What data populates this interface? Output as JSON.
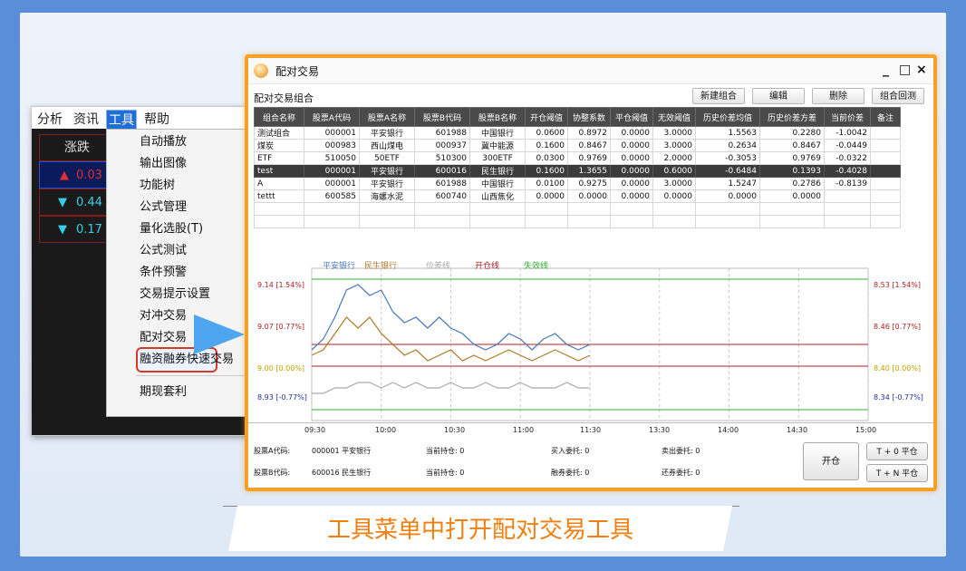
{
  "menu": {
    "bar": [
      "分析",
      "资讯",
      "工具",
      "帮助"
    ],
    "column_header": "涨跌",
    "values": [
      {
        "arrow": "▲",
        "value": "0.03",
        "color": "#e03030"
      },
      {
        "arrow": "▼",
        "value": "0.44",
        "color": "#35d0e8"
      },
      {
        "arrow": "▼",
        "value": "0.17",
        "color": "#35d0e8"
      }
    ],
    "items": [
      "自动播放",
      "输出图像",
      "功能树",
      "公式管理",
      "量化选股(T)",
      "公式测试",
      "条件预警",
      "交易提示设置",
      "对冲交易",
      "配对交易",
      "融资融券快速交易",
      "期现套利"
    ]
  },
  "window": {
    "title": "配对交易",
    "subtitle": "配对交易组合",
    "controls": [
      "_",
      "□",
      "×"
    ],
    "buttons": {
      "new": "新建组合",
      "edit": "编辑",
      "delete": "删除",
      "backtest": "组合回测"
    }
  },
  "table": {
    "headers": [
      "组合名称",
      "股票A代码",
      "股票A名称",
      "股票B代码",
      "股票B名称",
      "开仓阈值",
      "协整系数",
      "平仓阈值",
      "无效阈值",
      "历史价差均值",
      "历史价差方差",
      "当前价差",
      "备注"
    ],
    "rows": [
      [
        "测试组合",
        "000001",
        "平安银行",
        "601988",
        "中国银行",
        "0.0600",
        "0.8972",
        "0.0000",
        "3.0000",
        "1.5563",
        "0.2280",
        "-1.0042",
        ""
      ],
      [
        "煤炭",
        "000983",
        "西山煤电",
        "000937",
        "冀中能源",
        "0.1600",
        "0.8467",
        "0.0000",
        "3.0000",
        "0.2634",
        "0.8467",
        "-0.0449",
        ""
      ],
      [
        "ETF",
        "510050",
        "50ETF",
        "510300",
        "300ETF",
        "0.0300",
        "0.9769",
        "0.0000",
        "2.0000",
        "-0.3053",
        "0.9769",
        "-0.0322",
        ""
      ],
      [
        "test",
        "000001",
        "平安银行",
        "600016",
        "民生银行",
        "0.1600",
        "1.3655",
        "0.0000",
        "0.6000",
        "-0.6484",
        "0.1393",
        "-0.4028",
        ""
      ],
      [
        "A",
        "000001",
        "平安银行",
        "601988",
        "中国银行",
        "0.0100",
        "0.9275",
        "0.0000",
        "3.0000",
        "1.5247",
        "0.2786",
        "-0.8139",
        ""
      ],
      [
        "tettt",
        "600585",
        "海螺水泥",
        "600740",
        "山西焦化",
        "0.0000",
        "0.0000",
        "0.0000",
        "0.0000",
        "0.0000",
        "0.0000",
        "",
        ""
      ]
    ],
    "selected_row": 3
  },
  "chart_data": {
    "type": "line",
    "legend": [
      {
        "name": "平安银行",
        "color": "#4a78b8"
      },
      {
        "name": "民生银行",
        "color": "#b07a2c"
      },
      {
        "name": "价差线",
        "color": "#aaaaaa"
      },
      {
        "name": "开仓线",
        "color": "#b02020"
      },
      {
        "name": "失效线",
        "color": "#30b030"
      }
    ],
    "left_axis": [
      {
        "label": "9.14 [1.54%]",
        "color": "#b02020"
      },
      {
        "label": "9.07 [0.77%]",
        "color": "#b02020"
      },
      {
        "label": "9.00 [0.00%]",
        "color": "#c0a000"
      },
      {
        "label": "8.93 [-0.77%]",
        "color": "#2030a0"
      }
    ],
    "right_axis": [
      {
        "label": "8.53 [1.54%]",
        "color": "#b02020"
      },
      {
        "label": "8.46 [0.77%]",
        "color": "#b02020"
      },
      {
        "label": "8.40 [0.00%]",
        "color": "#c0a000"
      },
      {
        "label": "8.34 [-0.77%]",
        "color": "#2030a0"
      }
    ],
    "x_ticks": [
      "09:30",
      "10:00",
      "10:30",
      "11:00",
      "11:30",
      "13:30",
      "14:00",
      "14:30",
      "15:00"
    ],
    "x_index": [
      0,
      6,
      12,
      18,
      24,
      30,
      36,
      42,
      48
    ],
    "series": [
      {
        "name": "平安银行",
        "values": [
          9.01,
          9.03,
          9.07,
          9.12,
          9.13,
          9.11,
          9.12,
          9.08,
          9.06,
          9.07,
          9.05,
          9.07,
          9.05,
          9.04,
          9.02,
          9.01,
          9.02,
          9.04,
          9.03,
          9.01,
          9.03,
          9.04,
          9.02,
          9.01,
          9.02
        ]
      },
      {
        "name": "民生银行",
        "values": [
          9.0,
          9.01,
          9.04,
          9.07,
          9.05,
          9.07,
          9.04,
          9.02,
          9.0,
          9.01,
          8.99,
          9.0,
          9.01,
          8.99,
          9.0,
          8.99,
          9.0,
          9.01,
          9.0,
          8.99,
          9.0,
          9.01,
          9.0,
          8.99,
          9.0
        ]
      },
      {
        "name": "价差线",
        "values": [
          8.93,
          8.93,
          8.94,
          8.94,
          8.95,
          8.95,
          8.94,
          8.95,
          8.94,
          8.95,
          8.94,
          8.94,
          8.95,
          8.94,
          8.94,
          8.95,
          8.94,
          8.94,
          8.95,
          8.94,
          8.94,
          8.94,
          8.95,
          8.94,
          8.94
        ]
      }
    ],
    "open_lines": [
      9.02,
      8.98
    ],
    "invalid_lines": [
      9.14,
      8.9
    ],
    "ylim": [
      8.88,
      9.16
    ]
  },
  "footer": {
    "a_code_label": "股票A代码:",
    "a_code": "000001 平安银行",
    "b_code_label": "股票B代码:",
    "b_code": "600016 民生银行",
    "pos_a": "当前持仓: 0",
    "pos_b": "当前持仓: 0",
    "buy_entrust": "买入委托: 0",
    "margin_entrust": "融券委托: 0",
    "sell_entrust": "卖出委托: 0",
    "repay_entrust": "还券委托: 0",
    "open_btn": "开仓",
    "t0_btn": "T + 0 平仓",
    "tn_btn": "T + N 平仓"
  },
  "caption": "工具菜单中打开配对交易工具"
}
